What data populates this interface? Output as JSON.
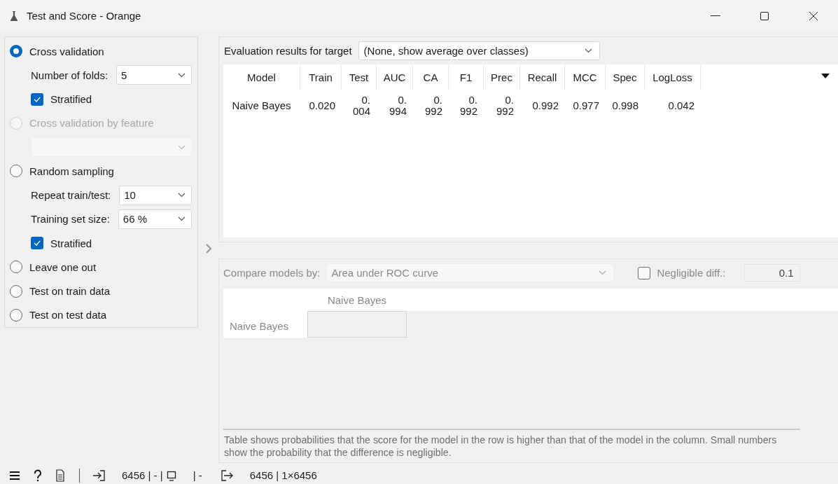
{
  "window": {
    "title": "Test and Score - Orange"
  },
  "sampling": {
    "options": [
      {
        "kind": "radio",
        "label": "Cross validation",
        "selected": true,
        "disabled": false
      },
      {
        "kind": "dropdown-row",
        "label": "Number of folds:",
        "value": "5",
        "disabled": false
      },
      {
        "kind": "checkbox",
        "label": "Stratified",
        "checked": true,
        "disabled": false
      },
      {
        "kind": "radio",
        "label": "Cross validation by feature",
        "selected": false,
        "disabled": true
      },
      {
        "kind": "dropdown",
        "disabled": true
      },
      {
        "kind": "radio",
        "label": "Random sampling",
        "selected": false,
        "disabled": false
      },
      {
        "kind": "dropdown-row",
        "label": "Repeat train/test:",
        "value": "10",
        "disabled": false
      },
      {
        "kind": "dropdown-row",
        "label": "Training set size:",
        "value": "66 %",
        "disabled": false
      },
      {
        "kind": "checkbox",
        "label": "Stratified",
        "checked": true,
        "disabled": false
      },
      {
        "kind": "radio",
        "label": "Leave one out",
        "selected": false,
        "disabled": false
      },
      {
        "kind": "radio",
        "label": "Test on train data",
        "selected": false,
        "disabled": false
      },
      {
        "kind": "radio",
        "label": "Test on test data",
        "selected": false,
        "disabled": false
      }
    ]
  },
  "evaluation": {
    "label": "Evaluation results for target",
    "target": "(None, show average over classes)",
    "columns": [
      "Model",
      "Train",
      "Test",
      "AUC",
      "CA",
      "F1",
      "Prec",
      "Recall",
      "MCC",
      "Spec",
      "LogLoss"
    ],
    "rows": [
      {
        "cells": [
          "Naive Bayes",
          "0.020",
          "0.004",
          "0.994",
          "0.992",
          "0.992",
          "0.992",
          "0.992",
          "0.977",
          "0.998",
          "0.042"
        ]
      }
    ]
  },
  "compare": {
    "label": "Compare models by:",
    "metric": "Area under ROC curve",
    "disabled": true,
    "negligible": {
      "label": "Negligible diff.:",
      "checked": false,
      "value": "0.1"
    },
    "columns": [
      "Naive Bayes"
    ],
    "rows": [
      {
        "header": "Naive Bayes"
      }
    ],
    "note": "Table shows probabilities that the score for the model in the row is higher than that of the model in the column. Small numbers show the probability that the difference is negligible."
  },
  "status_bar": {
    "input_count": "6456 | - |",
    "input_rest": "| -",
    "output": "6456 | 1×6456"
  }
}
